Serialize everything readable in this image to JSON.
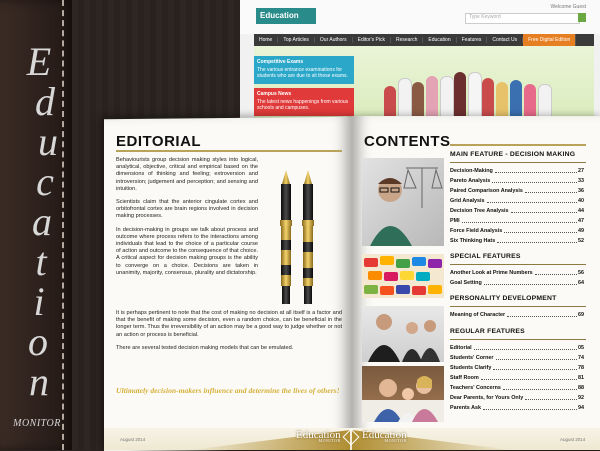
{
  "sidebar": {
    "letters": [
      "E",
      "d",
      "u",
      "c",
      "a",
      "t",
      "i",
      "o",
      "n"
    ],
    "tag": "MONITOR"
  },
  "website": {
    "logo": "Education",
    "meta_right": "Welcome Guest",
    "search_placeholder": "Type Keyword",
    "nav": [
      "Home",
      "Top Articles",
      "Our Authors",
      "Editor's Pick",
      "Research",
      "Education",
      "Features",
      "Contact Us",
      "Free Digital Edition"
    ],
    "card1_title": "Competitive Exams",
    "card1_text": "The various entrance examinations for students who are due to sit these exams.",
    "card2_title": "Campus News",
    "card2_text": "The latest news happenings from various schools and campuses."
  },
  "editorial": {
    "heading": "EDITORIAL",
    "paragraphs": [
      "Behaviourists group decision making styles into logical, analytical, objective, critical and empirical based on the dimensions of thinking and feeling; extroversion and introversion; judgement and perception; and sensing and intuition.",
      "Scientists claim that the anterior cingulate cortex and orbitofrontal cortex are brain regions involved in decision making processes.",
      "In decision-making in groups we talk about process and outcome where process refers to the interactions among individuals that lead to the choice of a particular course of action and outcome to the consequence of that choice. A critical aspect for decision making groups is the ability to converge on a choice. Decisions are taken in unanimity, majority, consensus, plurality and dictatorship."
    ],
    "tail_paragraphs": [
      "It is perhaps pertinent to note that the cost of making no decision at all itself is a factor and that the benefit of making some decision, even a random choice, can be beneficial in the longer term. Thus the irreversibility of an action may be a good way to judge whether or not an action or process is beneficial.",
      "There are several tested decision making models that can be emulated."
    ],
    "quote": "Ultimately decision-makers influence and determine the lives of others!"
  },
  "contents": {
    "heading": "CONTENTS",
    "sections": [
      {
        "title": "MAIN FEATURE - DECISION MAKING",
        "items": [
          {
            "label": "Decision-Making",
            "page": "27"
          },
          {
            "label": "Pareto Analysis",
            "page": "33"
          },
          {
            "label": "Paired Comparison Analysis",
            "page": "36"
          },
          {
            "label": "Grid Analysis",
            "page": "40"
          },
          {
            "label": "Decision Tree Analysis",
            "page": "44"
          },
          {
            "label": "PMI",
            "page": "47"
          },
          {
            "label": "Force Field Analysis",
            "page": "49"
          },
          {
            "label": "Six Thinking Hats",
            "page": "52"
          }
        ]
      },
      {
        "title": "SPECIAL FEATURES",
        "items": [
          {
            "label": "Another Look at Prime Numbers",
            "page": "56"
          },
          {
            "label": "Goal Setting",
            "page": "64"
          }
        ]
      },
      {
        "title": "PERSONALITY DEVELOPMENT",
        "items": [
          {
            "label": "Meaning of Character",
            "page": "69"
          }
        ]
      },
      {
        "title": "REGULAR FEATURES",
        "items": [
          {
            "label": "Editorial",
            "page": "05"
          },
          {
            "label": "Students' Corner",
            "page": "74"
          },
          {
            "label": "Students Clarify",
            "page": "78"
          },
          {
            "label": "Staff Room",
            "page": "81"
          },
          {
            "label": "Teachers' Concerns",
            "page": "88"
          },
          {
            "label": "Dear Parents, for Yours Only",
            "page": "92"
          },
          {
            "label": "Parents Ask",
            "page": "94"
          }
        ]
      }
    ]
  },
  "footer": {
    "date_left": "August 2014",
    "date_right": "August 2014",
    "logo": "Education",
    "logo_sub": "MONITOR"
  },
  "colors": {
    "accent_gold": "#b9a25a",
    "quote_gold": "#d6b13a",
    "site_teal": "#2a8c8a",
    "site_orange": "#e67e22"
  }
}
